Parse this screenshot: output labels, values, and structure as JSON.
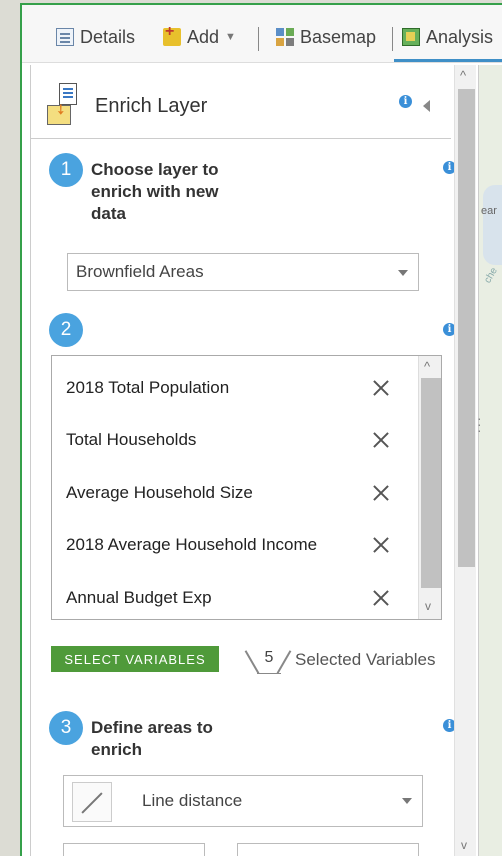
{
  "toolbar": {
    "details_label": "Details",
    "add_label": "Add",
    "basemap_label": "Basemap",
    "analysis_label": "Analysis"
  },
  "panel": {
    "title": "Enrich Layer",
    "step1": {
      "number": "1",
      "label": "Choose layer to enrich with new data",
      "selected_layer": "Brownfield Areas"
    },
    "step2": {
      "number": "2",
      "variables": [
        "2018 Total Population",
        "Total Households",
        "Average Household Size",
        "2018 Average Household Income",
        "Annual Budget Exp"
      ],
      "select_button_label": "SELECT VARIABLES",
      "selected_count": "5",
      "selected_label": "Selected Variables"
    },
    "step3": {
      "number": "3",
      "label": "Define areas to enrich",
      "area_type": "Line distance"
    }
  },
  "map": {
    "fragment_text_1": "ear",
    "fragment_text_2": "che"
  },
  "colors": {
    "accent_blue": "#4aa3df",
    "button_green": "#4f9a3a",
    "frame_green": "#35a04a",
    "info_blue": "#3a8fd8"
  }
}
